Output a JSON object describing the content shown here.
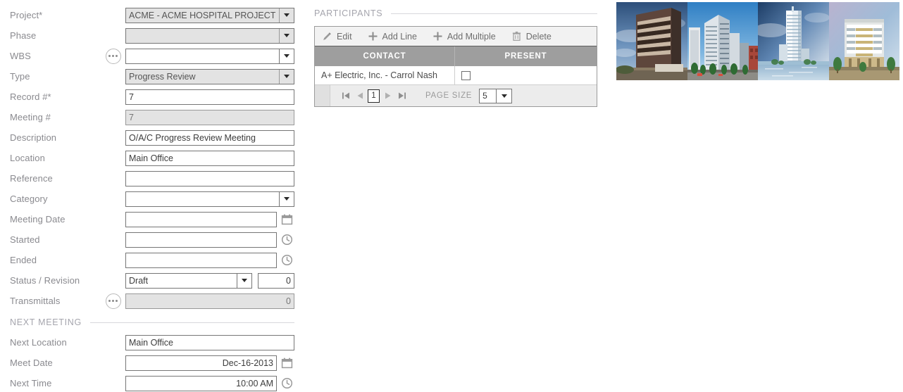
{
  "form": {
    "rows": [
      {
        "label": "Project*",
        "type": "combo",
        "value": "ACME - ACME HOSPITAL PROJECT",
        "filled": true,
        "ellipsis": false
      },
      {
        "label": "Phase",
        "type": "combo",
        "value": "",
        "filled": true,
        "ellipsis": false
      },
      {
        "label": "WBS",
        "type": "combo-split",
        "value": "",
        "filled": false,
        "ellipsis": true
      },
      {
        "label": "Type",
        "type": "combo",
        "value": "Progress Review",
        "filled": true,
        "ellipsis": false
      },
      {
        "label": "Record #*",
        "type": "text",
        "value": "7",
        "filled": false,
        "ellipsis": false
      },
      {
        "label": "Meeting #",
        "type": "text",
        "value": "7",
        "filled": true,
        "ellipsis": false
      },
      {
        "label": "Description",
        "type": "text",
        "value": "O/A/C Progress Review Meeting",
        "filled": false,
        "ellipsis": false
      },
      {
        "label": "Location",
        "type": "text",
        "value": "Main Office",
        "filled": false,
        "ellipsis": false
      },
      {
        "label": "Reference",
        "type": "text",
        "value": "",
        "filled": false,
        "ellipsis": false
      },
      {
        "label": "Category",
        "type": "combo-split",
        "value": "",
        "filled": false,
        "ellipsis": false
      },
      {
        "label": "Meeting Date",
        "type": "date",
        "value": "",
        "filled": false,
        "ellipsis": false
      },
      {
        "label": "Started",
        "type": "time",
        "value": "",
        "filled": false,
        "ellipsis": false
      },
      {
        "label": "Ended",
        "type": "time",
        "value": "",
        "filled": false,
        "ellipsis": false
      }
    ],
    "status_row": {
      "label": "Status / Revision",
      "status_value": "Draft",
      "revision_value": "0"
    },
    "transmittals_row": {
      "label": "Transmittals",
      "value": "0",
      "ellipsis": true
    },
    "next_meeting_section": {
      "title": "NEXT MEETING",
      "rows": [
        {
          "label": "Next Location",
          "type": "text",
          "value": "Main Office",
          "align": "left"
        },
        {
          "label": "Meet Date",
          "type": "date",
          "value": "Dec-16-2013",
          "align": "right"
        },
        {
          "label": "Next Time",
          "type": "time",
          "value": "10:00 AM",
          "align": "right"
        }
      ]
    }
  },
  "participants": {
    "title": "PARTICIPANTS",
    "toolbar": [
      {
        "label": "Edit",
        "icon": "pencil-icon"
      },
      {
        "label": "Add Line",
        "icon": "plus-icon"
      },
      {
        "label": "Add Multiple",
        "icon": "plus-icon"
      },
      {
        "label": "Delete",
        "icon": "trash-icon"
      }
    ],
    "columns": [
      "CONTACT",
      "PRESENT"
    ],
    "rows": [
      {
        "contact": "A+ Electric, Inc. - Carrol Nash",
        "present": false
      }
    ],
    "pager": {
      "first_icon": "first-page-icon",
      "prev_icon": "prev-page-icon",
      "page": "1",
      "next_icon": "next-page-icon",
      "last_icon": "last-page-icon",
      "page_size_label": "PAGE SIZE",
      "page_size_value": "5"
    }
  },
  "thumbnails": [
    {
      "name": "brick-office-building-photo"
    },
    {
      "name": "glass-highrise-render"
    },
    {
      "name": "waterfront-tower-render"
    },
    {
      "name": "mid-rise-residential-render"
    }
  ],
  "colors": {
    "label_gray": "#8a8a8f",
    "section_gray": "#a5a5ad",
    "input_border": "#767676",
    "disabled_bg": "#e3e3e3",
    "grid_header_bg": "#9e9e9e",
    "toolbar_bg": "#f2f2f2",
    "pager_bg": "#ececec"
  }
}
